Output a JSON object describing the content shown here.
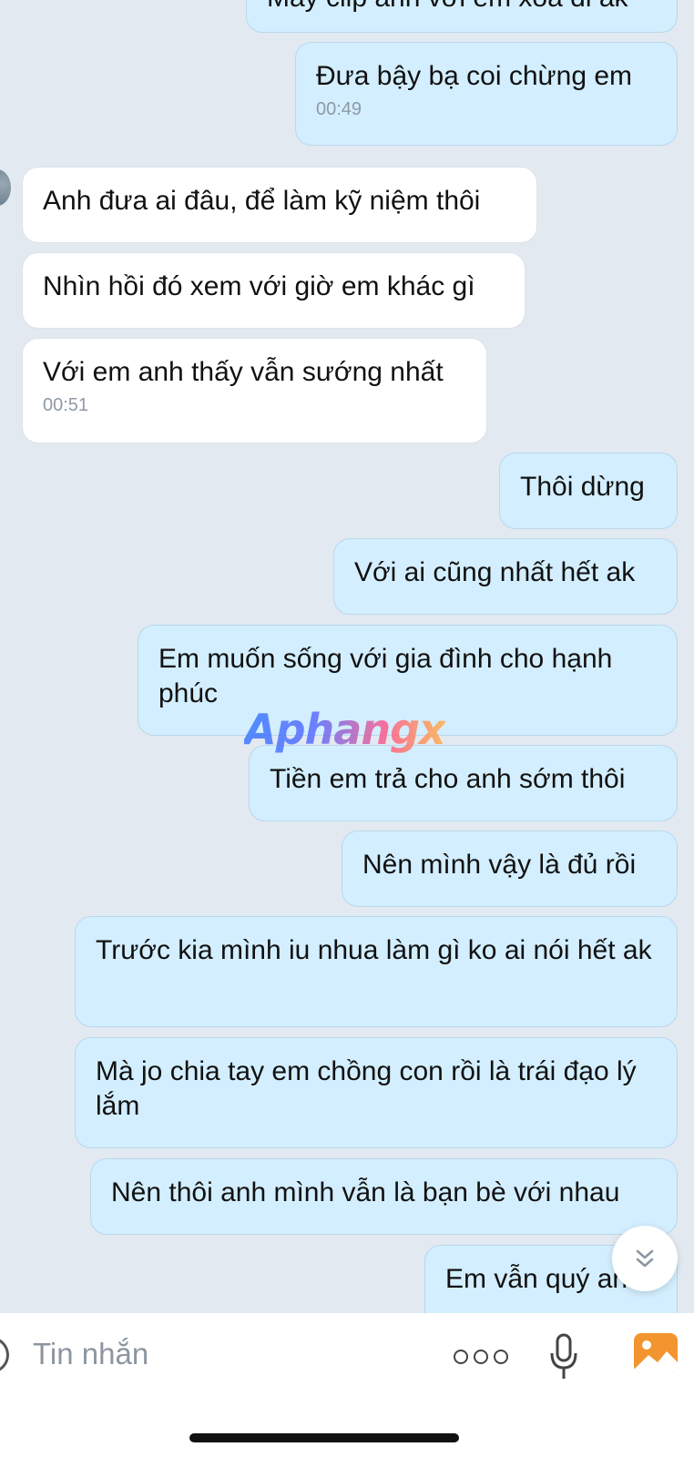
{
  "messages": [
    {
      "dir": "out",
      "text": "Mấy clip anh với em xóa đi ak",
      "time": ""
    },
    {
      "dir": "out",
      "text": "Đưa bậy bạ coi chừng em",
      "time": "00:49"
    },
    {
      "dir": "in",
      "text": "Anh đưa ai đâu, để làm kỹ niệm thôi",
      "time": ""
    },
    {
      "dir": "in",
      "text": "Nhìn hồi đó xem với giờ em khác gì",
      "time": ""
    },
    {
      "dir": "in",
      "text": "Với em anh thấy vẫn sướng nhất",
      "time": "00:51"
    },
    {
      "dir": "out",
      "text": "Thôi dừng",
      "time": ""
    },
    {
      "dir": "out",
      "text": "Với ai cũng nhất hết ak",
      "time": ""
    },
    {
      "dir": "out",
      "text": "Em muốn sống với gia đình cho hạnh phúc",
      "time": ""
    },
    {
      "dir": "out",
      "text": "Tiền em trả cho anh sớm thôi",
      "time": ""
    },
    {
      "dir": "out",
      "text": "Nên mình vậy là đủ rồi",
      "time": ""
    },
    {
      "dir": "out",
      "text": "Trước kia mình iu nhua làm gì ko ai nói hết ak",
      "time": ""
    },
    {
      "dir": "out",
      "text": "Mà jo chia tay em chồng con rồi là trái đạo lý lắm",
      "time": ""
    },
    {
      "dir": "out",
      "text": "Nên thôi anh mình vẫn là bạn bè với nhau",
      "time": ""
    },
    {
      "dir": "out",
      "text": "Em vẫn quý anh",
      "time": ""
    }
  ],
  "watermark": "Aphangx",
  "composer": {
    "placeholder": "Tin nhắn",
    "icons": [
      "emoji-icon",
      "more-icon",
      "mic-icon",
      "image-icon"
    ]
  },
  "scroll_button_icon": "double-chevron-down-icon",
  "colors": {
    "background": "#e2e9f1",
    "outgoing": "#d3eefe",
    "incoming": "#ffffff",
    "accent": "#f2952f"
  }
}
